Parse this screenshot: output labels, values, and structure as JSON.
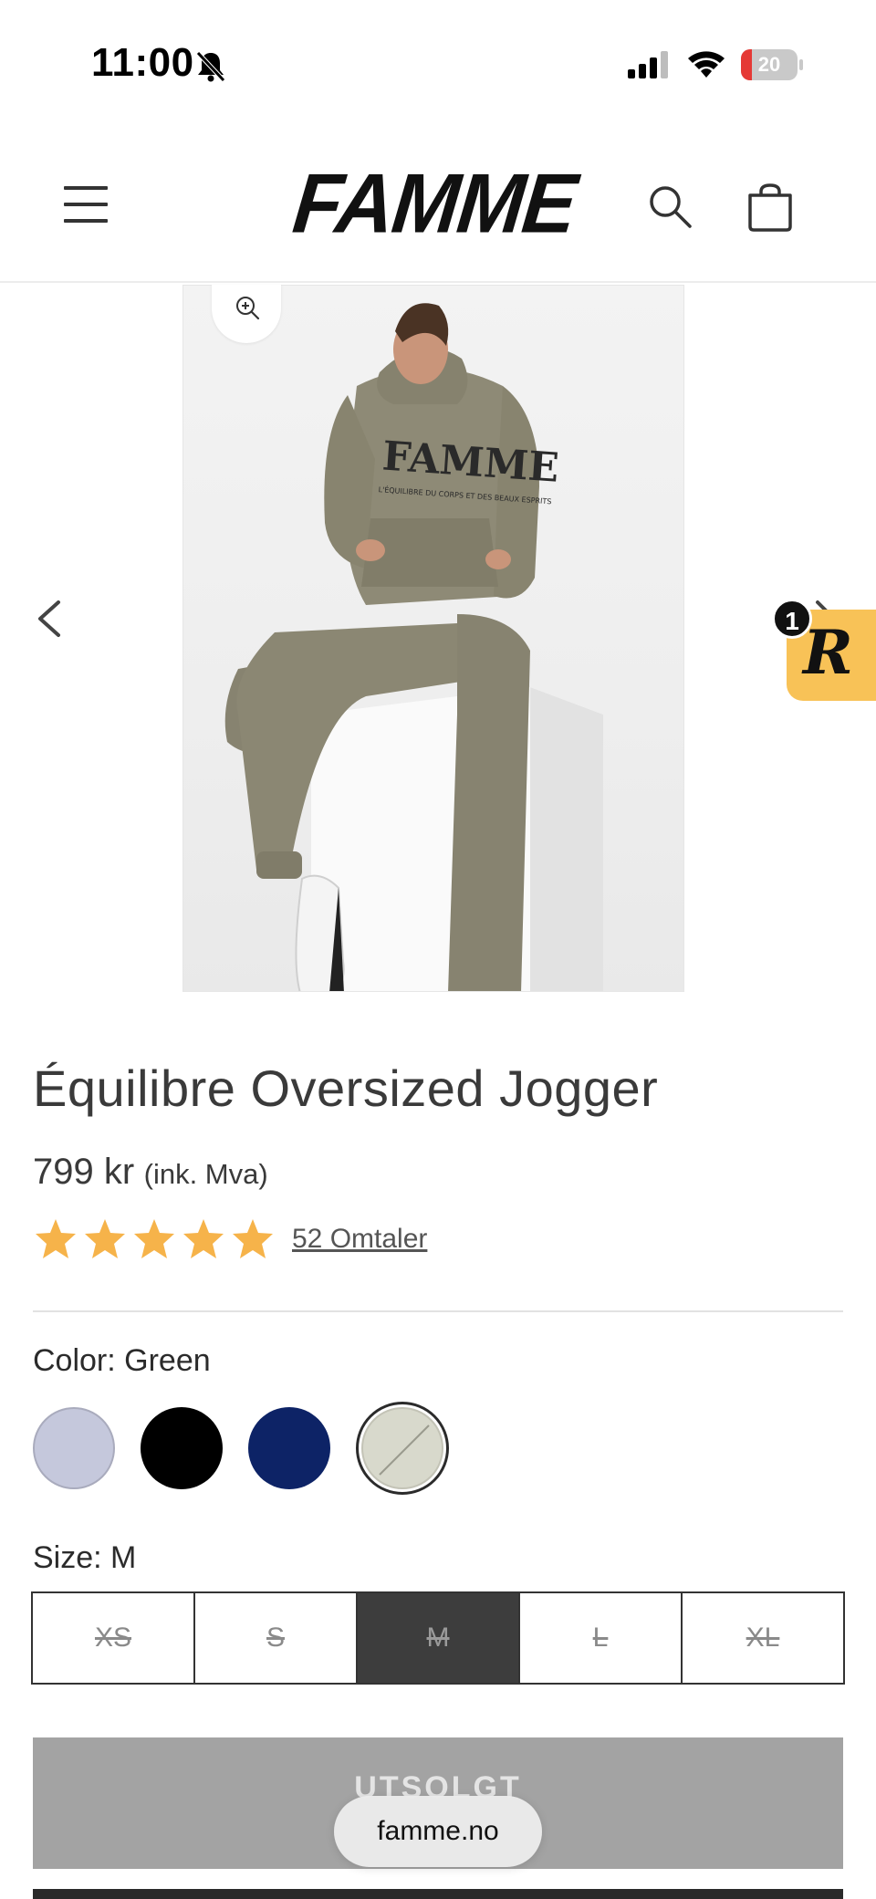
{
  "status_bar": {
    "time": "11:00",
    "battery_percent": "20",
    "battery_level": 0.2
  },
  "header": {
    "logo_text": "FAMME",
    "icons": [
      "menu-icon",
      "search-icon",
      "cart-icon"
    ]
  },
  "gallery": {
    "icons": [
      "zoom-in-icon",
      "chevron-left-icon",
      "chevron-right-icon"
    ],
    "rewards_badge": {
      "letter": "R",
      "count": "1"
    },
    "image_description_colors": {
      "garment": "#8a8672",
      "background": "#efefef"
    }
  },
  "product": {
    "title": "Équilibre Oversized Jogger",
    "price": "799 kr",
    "price_note": "(ink. Mva)",
    "rating": 5,
    "rating_max": 5,
    "reviews_text": "52 Omtaler",
    "star_color": "#f6b34a"
  },
  "color_selector": {
    "label": "Color: Green",
    "swatches": [
      {
        "color": "#c5c8dc",
        "selected": false
      },
      {
        "color": "#000000",
        "selected": false
      },
      {
        "color": "#0d2366",
        "selected": false
      },
      {
        "color": "#d8d9cc",
        "selected": true
      }
    ]
  },
  "size_selector": {
    "label": "Size: M",
    "options": [
      {
        "label": "XS",
        "selected": false
      },
      {
        "label": "S",
        "selected": false
      },
      {
        "label": "M",
        "selected": true
      },
      {
        "label": "L",
        "selected": false
      },
      {
        "label": "XL",
        "selected": false
      }
    ]
  },
  "buy": {
    "sold_out_label": "UTSOLGT"
  },
  "browser": {
    "url": "famme.no"
  }
}
